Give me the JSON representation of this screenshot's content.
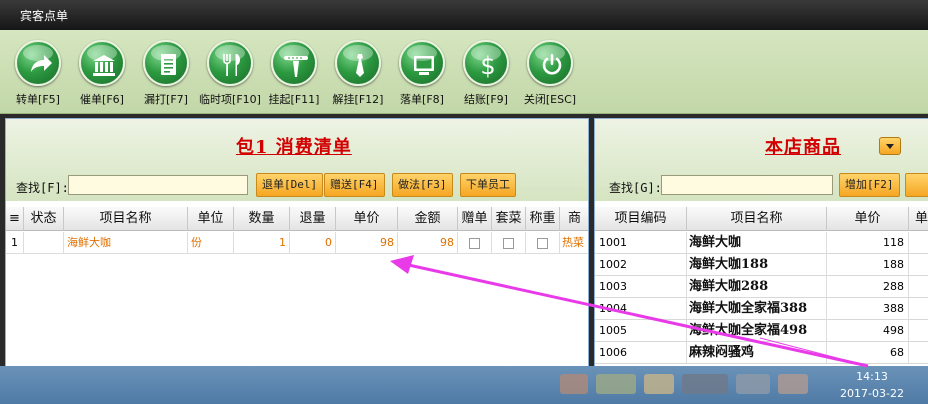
{
  "window": {
    "title": "宾客点单"
  },
  "toolbar": {
    "buttons": [
      {
        "label": "转单[F5]"
      },
      {
        "label": "催单[F6]"
      },
      {
        "label": "漏打[F7]"
      },
      {
        "label": "临时项[F10]"
      },
      {
        "label": "挂起[F11]"
      },
      {
        "label": "解挂[F12]"
      },
      {
        "label": "落单[F8]"
      },
      {
        "label": "结账[F9]"
      },
      {
        "label": "关闭[ESC]"
      }
    ]
  },
  "left_panel": {
    "title": "包1 消费清单",
    "find_label": "查找[F]:",
    "find_value": "",
    "buttons": {
      "return": "退单[Del]",
      "gift": "赠送[F4]",
      "method": "做法[F3]",
      "staff": "下单员工"
    },
    "columns": [
      "状态",
      "项目名称",
      "单位",
      "数量",
      "退量",
      "单价",
      "金额",
      "赠单",
      "套菜",
      "称重",
      "商"
    ],
    "rows": [
      {
        "no": "1",
        "status": "",
        "name": "海鲜大咖",
        "unit": "份",
        "qty": "1",
        "ret": "0",
        "price": "98",
        "amount": "98",
        "cat": "热菜"
      }
    ]
  },
  "right_panel": {
    "title": "本店商品",
    "find_label": "查找[G]:",
    "find_value": "",
    "add_button": "增加[F2]",
    "columns": [
      "项目编码",
      "项目名称",
      "单价",
      "单"
    ],
    "rows": [
      {
        "code": "1001",
        "name": "海鲜大咖",
        "price": "118"
      },
      {
        "code": "1002",
        "name": "海鲜大咖188",
        "price": "188"
      },
      {
        "code": "1003",
        "name": "海鲜大咖288",
        "price": "288"
      },
      {
        "code": "1004",
        "name": "海鲜大咖全家福388",
        "price": "388"
      },
      {
        "code": "1005",
        "name": "海鲜大咖全家福498",
        "price": "498"
      },
      {
        "code": "1006",
        "name": "麻辣闷骚鸡",
        "price": "68"
      }
    ]
  },
  "taskbar": {
    "time": "14:13",
    "date": "2017-03-22"
  },
  "colors": {
    "accent": "#e07000",
    "title_red": "#d20000",
    "toolbar_green": "#2d9a41",
    "annotation_arrow": "#e83ae8"
  }
}
